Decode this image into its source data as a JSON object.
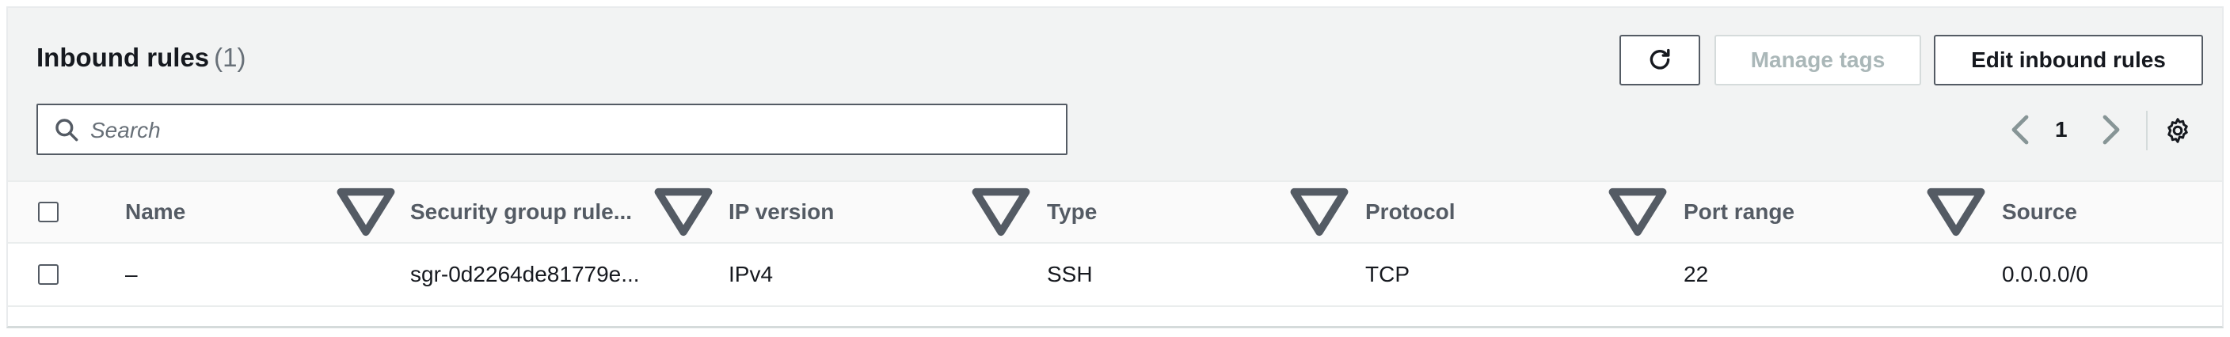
{
  "panel": {
    "title": "Inbound rules",
    "count": "(1)"
  },
  "actions": {
    "refresh_icon": "refresh-icon",
    "manage_tags_label": "Manage tags",
    "edit_inbound_rules_label": "Edit inbound rules"
  },
  "search": {
    "placeholder": "Search",
    "icon": "search-icon"
  },
  "pagination": {
    "current_page": "1",
    "prev_icon": "chevron-left-icon",
    "next_icon": "chevron-right-icon",
    "settings_icon": "gear-icon"
  },
  "table": {
    "columns": [
      "Name",
      "Security group rule...",
      "IP version",
      "Type",
      "Protocol",
      "Port range",
      "Source"
    ],
    "rows": [
      [
        "–",
        "sgr-0d2264de81779e...",
        "IPv4",
        "SSH",
        "TCP",
        "22",
        "0.0.0.0/0"
      ]
    ]
  },
  "colors": {
    "header_bg": "#f2f3f3",
    "text": "#16191f",
    "muted": "#687078",
    "border": "#545b64",
    "disabled": "#aab7b8"
  }
}
